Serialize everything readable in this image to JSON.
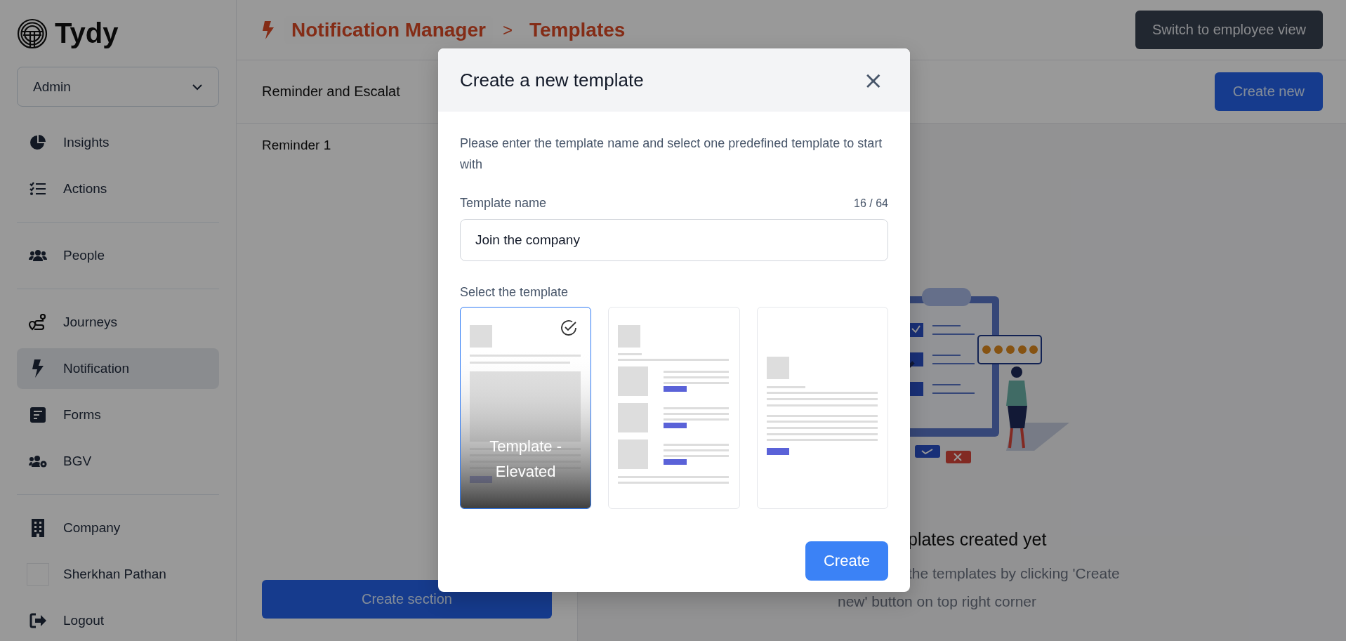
{
  "sidebar": {
    "logo": "Tydy",
    "role_select": {
      "value": "Admin"
    },
    "nav_groups": [
      [
        {
          "label": "Insights",
          "selected": false
        },
        {
          "label": "Actions",
          "selected": false
        }
      ],
      [
        {
          "label": "People",
          "selected": false
        }
      ],
      [
        {
          "label": "Journeys",
          "selected": false
        },
        {
          "label": "Notification",
          "selected": true
        },
        {
          "label": "Forms",
          "selected": false
        },
        {
          "label": "BGV",
          "selected": false
        }
      ],
      [
        {
          "label": "Company",
          "selected": false
        },
        {
          "label": "Sherkhan Pathan",
          "selected": false
        },
        {
          "label": "Logout",
          "selected": false
        }
      ]
    ]
  },
  "header": {
    "breadcrumb": [
      "Notification Manager",
      "Templates"
    ],
    "separator": ">",
    "switch_button": "Switch to employee view"
  },
  "toolbar": {
    "title": "Reminder and Escalat",
    "create_button": "Create new"
  },
  "sections": {
    "items": [
      "Reminder 1"
    ],
    "create_button": "Create section"
  },
  "empty_state": {
    "title": "plates created yet",
    "lines": [
      "the templates by clicking 'Create",
      "new' button on top right corner"
    ]
  },
  "modal": {
    "title": "Create a new template",
    "close": "×",
    "description": "Please enter the template name and select one predefined template to start with",
    "name_label": "Template name",
    "counter": "16 / 64",
    "name_value": "Join the company",
    "select_label": "Select the template",
    "templates": [
      {
        "kind": "hero",
        "selected": true,
        "label": "Template - Elevated"
      },
      {
        "kind": "list",
        "selected": false
      },
      {
        "kind": "letter",
        "selected": false
      }
    ],
    "create_button": "Create"
  }
}
